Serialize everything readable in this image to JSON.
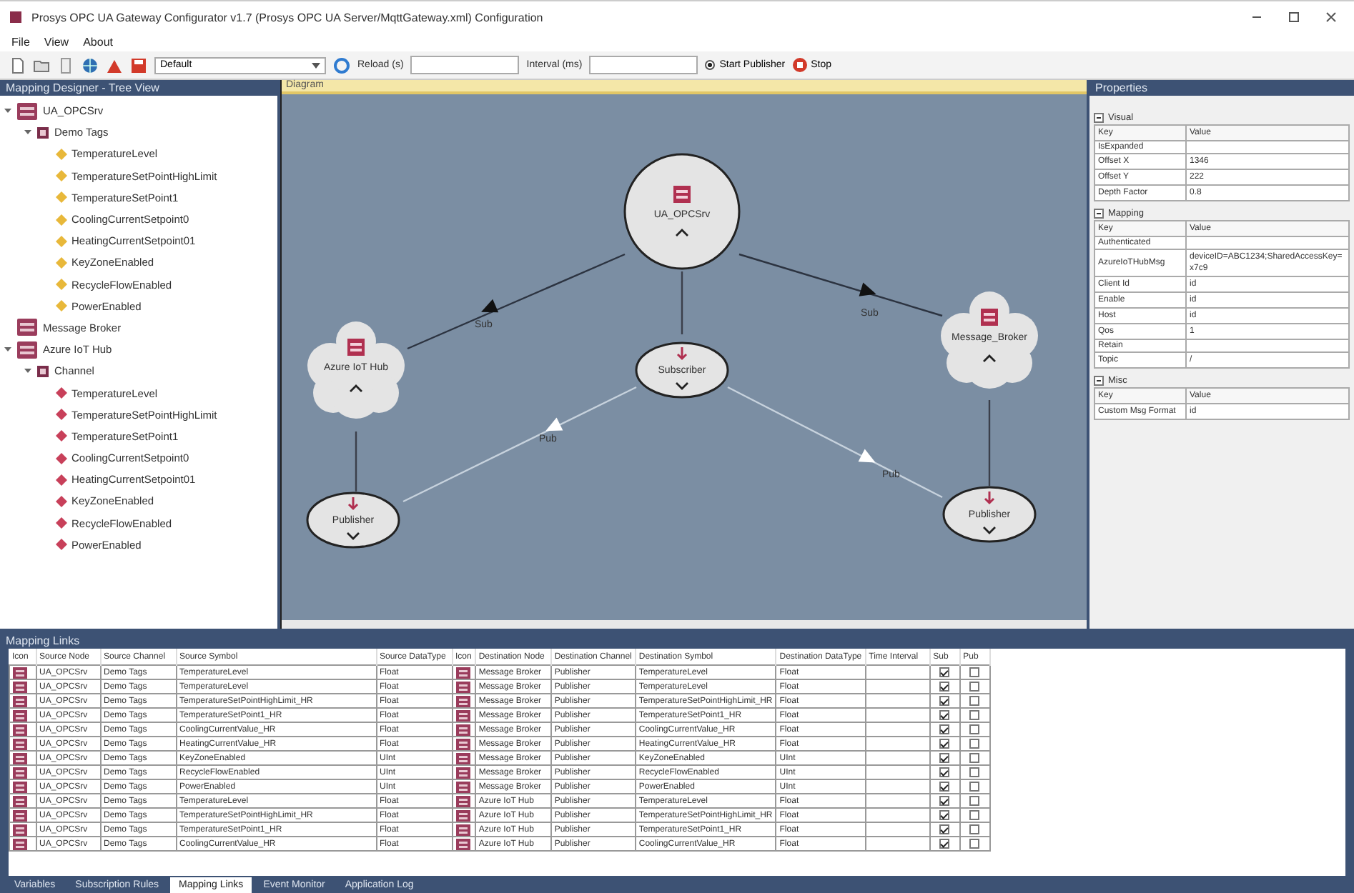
{
  "window": {
    "title": "Prosys OPC UA Gateway Configurator v1.7 (Prosys OPC UA Server/MqttGateway.xml) Configuration"
  },
  "menu": [
    "File",
    "View",
    "About"
  ],
  "toolbar": {
    "combo": "Default",
    "fields": [
      {
        "label": "Reload (s)"
      },
      {
        "label": "Interval (ms)"
      }
    ],
    "radio": {
      "label": "Start Publisher",
      "selected": true
    },
    "stop": "Stop"
  },
  "tree": {
    "title": "Mapping Designer - Tree View",
    "items": [
      {
        "label": "UA_OPCSrv",
        "kind": "server",
        "expanded": true,
        "children": [
          {
            "label": "Demo Tags",
            "kind": "channel",
            "expanded": true,
            "children": [
              {
                "label": "TemperatureLevel",
                "kind": "input-tag"
              },
              {
                "label": "TemperatureSetPointHighLimit",
                "kind": "input-tag"
              },
              {
                "label": "TemperatureSetPoint1",
                "kind": "input-tag"
              },
              {
                "label": "CoolingCurrentSetpoint0",
                "kind": "input-tag"
              },
              {
                "label": "HeatingCurrentSetpoint01",
                "kind": "input-tag"
              },
              {
                "label": "KeyZoneEnabled",
                "kind": "input-tag"
              },
              {
                "label": "RecycleFlowEnabled",
                "kind": "input-tag"
              },
              {
                "label": "PowerEnabled",
                "kind": "input-tag"
              }
            ]
          }
        ]
      },
      {
        "label": "Message Broker",
        "kind": "server"
      },
      {
        "label": "Azure IoT Hub",
        "kind": "server",
        "expanded": true,
        "children": [
          {
            "label": "Channel",
            "kind": "channel",
            "expanded": true,
            "children": [
              {
                "label": "TemperatureLevel",
                "kind": "output-tag"
              },
              {
                "label": "TemperatureSetPointHighLimit",
                "kind": "output-tag"
              },
              {
                "label": "TemperatureSetPoint1",
                "kind": "output-tag"
              },
              {
                "label": "CoolingCurrentSetpoint0",
                "kind": "output-tag"
              },
              {
                "label": "HeatingCurrentSetpoint01",
                "kind": "output-tag"
              },
              {
                "label": "KeyZoneEnabled",
                "kind": "output-tag"
              },
              {
                "label": "RecycleFlowEnabled",
                "kind": "output-tag"
              },
              {
                "label": "PowerEnabled",
                "kind": "output-tag"
              }
            ]
          }
        ]
      }
    ]
  },
  "diagram": {
    "title": "Diagram",
    "nodes": [
      {
        "label": "UA_OPCSrv",
        "kind": "circle",
        "expanded": true
      },
      {
        "label": "Azure IoT Hub",
        "kind": "cloud",
        "expanded": true
      },
      {
        "label": "Message_Broker",
        "kind": "cloud",
        "expanded": true
      },
      {
        "label": "Subscriber",
        "kind": "ellipse",
        "expanded": false
      },
      {
        "label": "Publisher",
        "kind": "ellipse",
        "expanded": false
      },
      {
        "label": "Publisher",
        "kind": "ellipse",
        "expanded": false
      }
    ],
    "edges": [
      {
        "label": "Sub",
        "kind": "dark"
      },
      {
        "label": "Sub",
        "kind": "dark"
      },
      {
        "label": "Pub",
        "kind": "light"
      },
      {
        "label": "Pub",
        "kind": "light"
      }
    ]
  },
  "properties": {
    "title": "Properties",
    "sections": [
      {
        "title": "Visual",
        "expanded": true,
        "columns": [
          "Key",
          "Value"
        ],
        "rows": [
          {
            "key": "IsExpanded"
          },
          {
            "key": "Offset X",
            "value": "1346"
          },
          {
            "key": "Offset Y",
            "value": "222"
          },
          {
            "key": "Depth Factor",
            "value": "0.8"
          }
        ]
      },
      {
        "title": "Mapping",
        "expanded": true,
        "columns": [
          "Key",
          "Value"
        ],
        "rows": [
          {
            "key": "Authenticated"
          },
          {
            "key": "AzureIoTHubMsg",
            "value": "deviceID=ABC1234;SharedAccessKey=x7c9"
          },
          {
            "key": "Client Id",
            "value": "id"
          },
          {
            "key": "Enable",
            "value": "id"
          },
          {
            "key": "Host",
            "value": "id"
          },
          {
            "key": "Qos",
            "value": "1"
          },
          {
            "key": "Retain"
          },
          {
            "key": "Topic",
            "value": "/"
          }
        ]
      },
      {
        "title": "Misc",
        "expanded": true,
        "columns": [
          "Key",
          "Value"
        ],
        "rows": [
          {
            "key": "Custom Msg Format",
            "value": "id"
          }
        ]
      }
    ]
  },
  "links": {
    "title": "Mapping Links",
    "columns": [
      "Icon",
      "Source Node",
      "Source Channel",
      "Source Symbol",
      "Source DataType",
      "Icon",
      "Destination Node",
      "Destination Channel",
      "Destination Symbol",
      "Destination DataType",
      "Time Interval",
      "Sub",
      "Pub"
    ],
    "rows": [
      {
        "src": "UA_OPCSrv",
        "ch": "Demo Tags",
        "sym": "TemperatureLevel",
        "type": "Float",
        "dst": "Message Broker",
        "dch": "Publisher",
        "dsym": "TemperatureLevel",
        "dtype": "Float",
        "sub": true,
        "pub": false
      },
      {
        "src": "UA_OPCSrv",
        "ch": "Demo Tags",
        "sym": "TemperatureLevel",
        "type": "Float",
        "dst": "Message Broker",
        "dch": "Publisher",
        "dsym": "TemperatureLevel",
        "dtype": "Float",
        "sub": true,
        "pub": false
      },
      {
        "src": "UA_OPCSrv",
        "ch": "Demo Tags",
        "sym": "TemperatureSetPointHighLimit_HR",
        "type": "Float",
        "dst": "Message Broker",
        "dch": "Publisher",
        "dsym": "TemperatureSetPointHighLimit_HR",
        "dtype": "Float",
        "sub": true,
        "pub": false
      },
      {
        "src": "UA_OPCSrv",
        "ch": "Demo Tags",
        "sym": "TemperatureSetPoint1_HR",
        "type": "Float",
        "dst": "Message Broker",
        "dch": "Publisher",
        "dsym": "TemperatureSetPoint1_HR",
        "dtype": "Float",
        "sub": true,
        "pub": false
      },
      {
        "src": "UA_OPCSrv",
        "ch": "Demo Tags",
        "sym": "CoolingCurrentValue_HR",
        "type": "Float",
        "dst": "Message Broker",
        "dch": "Publisher",
        "dsym": "CoolingCurrentValue_HR",
        "dtype": "Float",
        "sub": true,
        "pub": false
      },
      {
        "src": "UA_OPCSrv",
        "ch": "Demo Tags",
        "sym": "HeatingCurrentValue_HR",
        "type": "Float",
        "dst": "Message Broker",
        "dch": "Publisher",
        "dsym": "HeatingCurrentValue_HR",
        "dtype": "Float",
        "sub": true,
        "pub": false
      },
      {
        "src": "UA_OPCSrv",
        "ch": "Demo Tags",
        "sym": "KeyZoneEnabled",
        "type": "UInt",
        "dst": "Message Broker",
        "dch": "Publisher",
        "dsym": "KeyZoneEnabled",
        "dtype": "UInt",
        "sub": true,
        "pub": false
      },
      {
        "src": "UA_OPCSrv",
        "ch": "Demo Tags",
        "sym": "RecycleFlowEnabled",
        "type": "UInt",
        "dst": "Message Broker",
        "dch": "Publisher",
        "dsym": "RecycleFlowEnabled",
        "dtype": "UInt",
        "sub": true,
        "pub": false
      },
      {
        "src": "UA_OPCSrv",
        "ch": "Demo Tags",
        "sym": "PowerEnabled",
        "type": "UInt",
        "dst": "Message Broker",
        "dch": "Publisher",
        "dsym": "PowerEnabled",
        "dtype": "UInt",
        "sub": true,
        "pub": false
      },
      {
        "src": "UA_OPCSrv",
        "ch": "Demo Tags",
        "sym": "TemperatureLevel",
        "type": "Float",
        "dst": "Azure IoT Hub",
        "dch": "Publisher",
        "dsym": "TemperatureLevel",
        "dtype": "Float",
        "sub": true,
        "pub": false
      },
      {
        "src": "UA_OPCSrv",
        "ch": "Demo Tags",
        "sym": "TemperatureSetPointHighLimit_HR",
        "type": "Float",
        "dst": "Azure IoT Hub",
        "dch": "Publisher",
        "dsym": "TemperatureSetPointHighLimit_HR",
        "dtype": "Float",
        "sub": true,
        "pub": false
      },
      {
        "src": "UA_OPCSrv",
        "ch": "Demo Tags",
        "sym": "TemperatureSetPoint1_HR",
        "type": "Float",
        "dst": "Azure IoT Hub",
        "dch": "Publisher",
        "dsym": "TemperatureSetPoint1_HR",
        "dtype": "Float",
        "sub": true,
        "pub": false
      },
      {
        "src": "UA_OPCSrv",
        "ch": "Demo Tags",
        "sym": "CoolingCurrentValue_HR",
        "type": "Float",
        "dst": "Azure IoT Hub",
        "dch": "Publisher",
        "dsym": "CoolingCurrentValue_HR",
        "dtype": "Float",
        "sub": true,
        "pub": false
      }
    ]
  },
  "bottom_tabs": [
    {
      "label": "Variables",
      "selected": false
    },
    {
      "label": "Subscription Rules",
      "selected": false
    },
    {
      "label": "Mapping Links",
      "selected": true
    },
    {
      "label": "Event Monitor",
      "selected": false
    },
    {
      "label": "Application Log",
      "selected": false
    }
  ]
}
